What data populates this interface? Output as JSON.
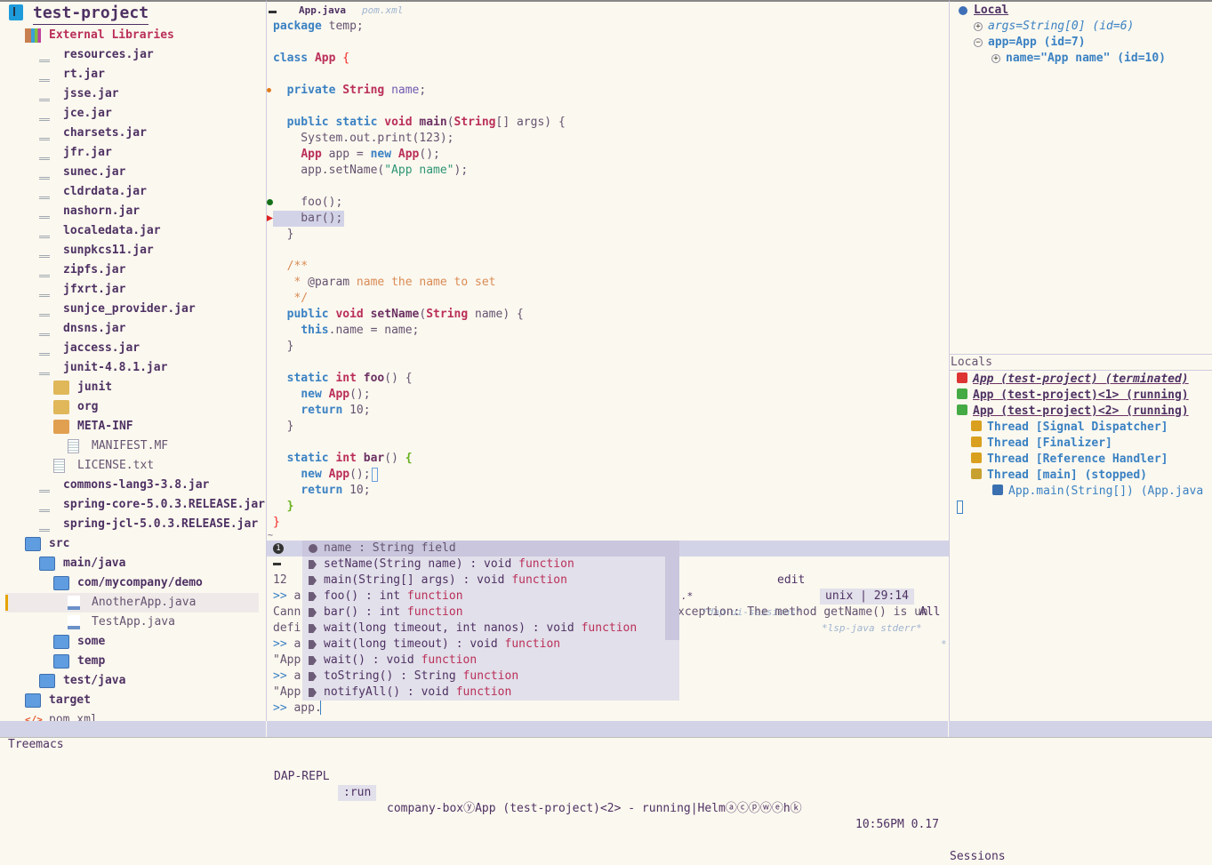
{
  "colors": {
    "background": "#fbf8ef",
    "keyword": "#3a81c3",
    "type": "#ba2f59",
    "modeline": "#d3d3e7",
    "popup": "#e2e0ea"
  },
  "tree": {
    "root": "test-project",
    "items": [
      {
        "label": "External Libraries",
        "icon": "library-icon",
        "depth": 1,
        "kind": "ext"
      },
      {
        "label": "resources.jar",
        "icon": "java-jar-icon",
        "depth": 2
      },
      {
        "label": "rt.jar",
        "icon": "java-jar-icon",
        "depth": 2
      },
      {
        "label": "jsse.jar",
        "icon": "java-jar-icon",
        "depth": 2
      },
      {
        "label": "jce.jar",
        "icon": "java-jar-icon",
        "depth": 2
      },
      {
        "label": "charsets.jar",
        "icon": "java-jar-icon",
        "depth": 2
      },
      {
        "label": "jfr.jar",
        "icon": "java-jar-icon",
        "depth": 2
      },
      {
        "label": "sunec.jar",
        "icon": "java-jar-icon",
        "depth": 2
      },
      {
        "label": "cldrdata.jar",
        "icon": "java-jar-icon",
        "depth": 2
      },
      {
        "label": "nashorn.jar",
        "icon": "java-jar-icon",
        "depth": 2
      },
      {
        "label": "localedata.jar",
        "icon": "java-jar-icon",
        "depth": 2
      },
      {
        "label": "sunpkcs11.jar",
        "icon": "java-jar-icon",
        "depth": 2
      },
      {
        "label": "zipfs.jar",
        "icon": "java-jar-icon",
        "depth": 2
      },
      {
        "label": "jfxrt.jar",
        "icon": "java-jar-icon",
        "depth": 2
      },
      {
        "label": "sunjce_provider.jar",
        "icon": "java-jar-icon",
        "depth": 2
      },
      {
        "label": "dnsns.jar",
        "icon": "java-jar-icon",
        "depth": 2
      },
      {
        "label": "jaccess.jar",
        "icon": "java-jar-icon",
        "depth": 2
      },
      {
        "label": "junit-4.8.1.jar",
        "icon": "java-jar-icon",
        "depth": 2
      },
      {
        "label": "junit",
        "icon": "package-folder-icon",
        "depth": 3
      },
      {
        "label": "org",
        "icon": "package-folder-icon",
        "depth": 3
      },
      {
        "label": "META-INF",
        "icon": "package-folder-open-icon",
        "depth": 3
      },
      {
        "label": "MANIFEST.MF",
        "icon": "text-file-icon",
        "depth": 4,
        "kind": "file"
      },
      {
        "label": "LICENSE.txt",
        "icon": "text-file-icon",
        "depth": 3,
        "kind": "file"
      },
      {
        "label": "commons-lang3-3.8.jar",
        "icon": "java-jar-icon",
        "depth": 2
      },
      {
        "label": "spring-core-5.0.3.RELEASE.jar",
        "icon": "java-jar-icon",
        "depth": 2
      },
      {
        "label": "spring-jcl-5.0.3.RELEASE.jar",
        "icon": "java-jar-icon",
        "depth": 2
      },
      {
        "label": "src",
        "icon": "folder-icon",
        "depth": 1
      },
      {
        "label": "main/java",
        "icon": "folder-icon",
        "depth": 2
      },
      {
        "label": "com/mycompany/demo",
        "icon": "folder-icon",
        "depth": 3
      },
      {
        "label": "AnotherApp.java",
        "icon": "java-file-icon",
        "depth": 4,
        "kind": "file",
        "selected": true
      },
      {
        "label": "TestApp.java",
        "icon": "java-file-icon",
        "depth": 4,
        "kind": "file"
      },
      {
        "label": "some",
        "icon": "folder-icon",
        "depth": 3
      },
      {
        "label": "temp",
        "icon": "folder-icon",
        "depth": 3
      },
      {
        "label": "test/java",
        "icon": "folder-icon",
        "depth": 2
      },
      {
        "label": "target",
        "icon": "folder-icon",
        "depth": 1
      },
      {
        "label": "pom.xml",
        "icon": "xml-file-icon",
        "depth": 1,
        "kind": "file"
      }
    ]
  },
  "editor": {
    "tabs": [
      {
        "label": "App.java",
        "active": true
      },
      {
        "label": "pom.xml",
        "active": false
      }
    ],
    "lines": [
      [
        [
          "package",
          "kw"
        ],
        [
          " temp;",
          ""
        ]
      ],
      [],
      [
        [
          "class",
          "kw"
        ],
        [
          " ",
          ""
        ],
        [
          "App",
          "ty"
        ],
        [
          " ",
          ""
        ],
        [
          "{",
          "b1"
        ]
      ],
      [],
      [
        [
          "  ",
          ""
        ],
        [
          "private",
          "kw"
        ],
        [
          " ",
          ""
        ],
        [
          "String",
          "ty"
        ],
        [
          " ",
          ""
        ],
        [
          "name",
          "va"
        ],
        [
          ";",
          ""
        ]
      ],
      [],
      [
        [
          "  ",
          ""
        ],
        [
          "public",
          "kw"
        ],
        [
          " ",
          ""
        ],
        [
          "static",
          "kw"
        ],
        [
          " ",
          ""
        ],
        [
          "void",
          "ty"
        ],
        [
          " ",
          ""
        ],
        [
          "main",
          "fn"
        ],
        [
          "(",
          ""
        ],
        [
          "String",
          "ty"
        ],
        [
          "[] args) {",
          ""
        ]
      ],
      [
        [
          "    System.out.print(123);",
          ""
        ]
      ],
      [
        [
          "    ",
          ""
        ],
        [
          "App",
          "ty"
        ],
        [
          " app = ",
          ""
        ],
        [
          "new",
          "kw"
        ],
        [
          " ",
          ""
        ],
        [
          "App",
          "ty"
        ],
        [
          "();",
          ""
        ]
      ],
      [
        [
          "    app.setName(",
          ""
        ],
        [
          "\"App name\"",
          "st"
        ],
        [
          ");",
          ""
        ]
      ],
      [],
      [
        [
          "    foo();",
          ""
        ]
      ],
      [
        [
          "    bar();",
          ""
        ]
      ],
      [
        [
          "  }",
          ""
        ]
      ],
      [],
      [
        [
          "  /**",
          "dc"
        ]
      ],
      [
        [
          "   * ",
          "dc"
        ],
        [
          "@param",
          ""
        ],
        [
          " name the name to set",
          "dc"
        ]
      ],
      [
        [
          "   */",
          "dc"
        ]
      ],
      [
        [
          "  ",
          ""
        ],
        [
          "public",
          "kw"
        ],
        [
          " ",
          ""
        ],
        [
          "void",
          "ty"
        ],
        [
          " ",
          ""
        ],
        [
          "setName",
          "fn"
        ],
        [
          "(",
          ""
        ],
        [
          "String",
          "ty"
        ],
        [
          " name) {",
          ""
        ]
      ],
      [
        [
          "    ",
          ""
        ],
        [
          "this",
          "kw"
        ],
        [
          ".name = name;",
          ""
        ]
      ],
      [
        [
          "  }",
          ""
        ]
      ],
      [],
      [
        [
          "  ",
          ""
        ],
        [
          "static",
          "kw"
        ],
        [
          " ",
          ""
        ],
        [
          "int",
          "ty"
        ],
        [
          " ",
          ""
        ],
        [
          "foo",
          "fn"
        ],
        [
          "() {",
          ""
        ]
      ],
      [
        [
          "    ",
          ""
        ],
        [
          "new",
          "kw"
        ],
        [
          " ",
          ""
        ],
        [
          "App",
          "ty"
        ],
        [
          "();",
          ""
        ]
      ],
      [
        [
          "    ",
          ""
        ],
        [
          "return",
          "kw"
        ],
        [
          " 10;",
          ""
        ]
      ],
      [
        [
          "  }",
          ""
        ]
      ],
      [],
      [
        [
          "  ",
          ""
        ],
        [
          "static",
          "kw"
        ],
        [
          " ",
          ""
        ],
        [
          "int",
          "ty"
        ],
        [
          " ",
          ""
        ],
        [
          "bar",
          "fn"
        ],
        [
          "() ",
          ""
        ],
        [
          "{",
          "b2"
        ]
      ],
      [
        [
          "    ",
          ""
        ],
        [
          "new",
          "kw"
        ],
        [
          " ",
          ""
        ],
        [
          "App",
          "ty"
        ],
        [
          "();",
          ""
        ]
      ],
      [
        [
          "    ",
          ""
        ],
        [
          "return",
          "kw"
        ],
        [
          " 10;",
          ""
        ]
      ],
      [
        [
          "  ",
          ""
        ],
        [
          "}",
          "b2"
        ]
      ],
      [
        [
          "}",
          "b1"
        ]
      ]
    ],
    "modeline": {
      "state": "edit",
      "encoding": "unix | 29:14",
      "position": "All"
    }
  },
  "repl": {
    "tabs": [
      ".*",
      "*dap-ui-sessions*",
      "*lsp-java stderr*",
      "*"
    ],
    "lines": [
      {
        "text": "12"
      },
      {
        "prompt": ">> ",
        "text": "a"
      },
      {
        "text": "Cann",
        "right": "xception: The method getName() is un"
      },
      {
        "text": "defi"
      },
      {
        "prompt": ">> ",
        "text": "a"
      },
      {
        "text": "\"App"
      },
      {
        "prompt": ">> ",
        "text": "a"
      },
      {
        "text": "\"App"
      },
      {
        "prompt": ">> ",
        "text": "app."
      }
    ]
  },
  "completion": {
    "items": [
      {
        "label": "name : String field",
        "kind": "",
        "icon": "gear-icon",
        "selected": true
      },
      {
        "label": "setName(String name) : void ",
        "kind": "function"
      },
      {
        "label": "main(String[] args) : void ",
        "kind": "function"
      },
      {
        "label": "foo() : int ",
        "kind": "function"
      },
      {
        "label": "bar() : int ",
        "kind": "function"
      },
      {
        "label": "wait(long timeout, int nanos) : void ",
        "kind": "function"
      },
      {
        "label": "wait(long timeout) : void ",
        "kind": "function"
      },
      {
        "label": "wait() : void ",
        "kind": "function"
      },
      {
        "label": "toString() : String ",
        "kind": "function"
      },
      {
        "label": "notifyAll() : void ",
        "kind": "function"
      }
    ]
  },
  "locals": {
    "header": "Local",
    "vars": [
      {
        "label": "args=String[0] (id=6)",
        "depth": 1,
        "expander": "+",
        "italic": true
      },
      {
        "label": "app=App (id=7)",
        "depth": 1,
        "expander": "−"
      },
      {
        "label": "name=\"App name\" (id=10)",
        "depth": 2,
        "expander": "+"
      }
    ]
  },
  "sessions": {
    "header": "Locals",
    "items": [
      {
        "label": "App (test-project) (terminated)",
        "kind": "sess",
        "italic": true,
        "icon": "terminated-session-icon"
      },
      {
        "label": "App (test-project)<1> (running)",
        "kind": "sess",
        "icon": "running-session-icon"
      },
      {
        "label": "App (test-project)<2> (running)",
        "kind": "sess",
        "icon": "running-session-icon"
      },
      {
        "label": "Thread [Signal Dispatcher]",
        "kind": "thr",
        "icon": "running-thread-icon"
      },
      {
        "label": "Thread [Finalizer]",
        "kind": "thr",
        "icon": "running-thread-icon"
      },
      {
        "label": "Thread [Reference Handler]",
        "kind": "thr",
        "icon": "running-thread-icon"
      },
      {
        "label": "Thread [main] (stopped)",
        "kind": "thr",
        "icon": "stopped-thread-icon"
      },
      {
        "label": "App.main(String[]) (App.java",
        "kind": "frame",
        "icon": "stack-frame-icon"
      }
    ]
  },
  "statusbar": {
    "treemacs": "Treemacs",
    "repl_name": "DAP-REPL",
    "repl_mode": ":run",
    "repl_info": "company-boxⓨApp (test-project)<2> - running|Helmⓐⓒⓟⓦⓔhⓚ",
    "time": "10:56PM 0.17",
    "sessions": "Sessions"
  }
}
